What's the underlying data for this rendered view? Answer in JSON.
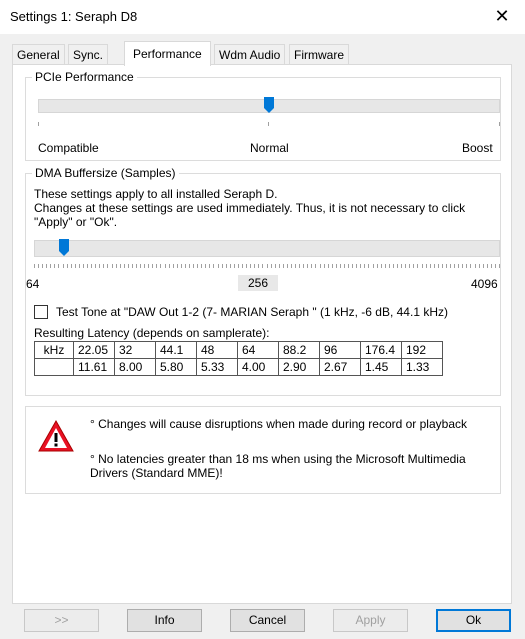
{
  "window": {
    "title": "Settings 1: Seraph D8",
    "close_symbol": "✕"
  },
  "tabs": [
    {
      "label": "General"
    },
    {
      "label": "Sync."
    },
    {
      "label": "Performance"
    },
    {
      "label": "Wdm Audio"
    },
    {
      "label": "Firmware"
    }
  ],
  "pcie": {
    "legend": "PCIe Performance",
    "labels": [
      "Compatible",
      "Normal",
      "Boost"
    ],
    "level": 0.5
  },
  "dma": {
    "legend": "DMA Buffersize (Samples)",
    "info_line1": "These settings apply to all installed Seraph D.",
    "info_line2": "Changes at these settings are used immediately. Thus, it is not necessary to click",
    "info_line3": "\"Apply\" or \"Ok\".",
    "min_label": "64",
    "current_value": "256",
    "max_label": "4096",
    "level": 0.055
  },
  "test_tone": {
    "label": "Test Tone at \"DAW Out  1-2 (7- MARIAN Seraph \" (1 kHz, -6 dB,  44.1 kHz)",
    "checked": false
  },
  "latency": {
    "caption": "Resulting Latency (depends on samplerate):",
    "header_unit": "kHz",
    "rates": [
      "22.05",
      "32",
      "44.1",
      "48",
      "64",
      "88.2",
      "96",
      "176.4",
      "192"
    ],
    "values": [
      "11.61",
      "8.00",
      "5.80",
      "5.33",
      "4.00",
      "2.90",
      "2.67",
      "1.45",
      "1.33"
    ]
  },
  "warning": {
    "line1": "° Changes will cause disruptions when made during record or playback",
    "line2a": "° No latencies greater than 18 ms when using the Microsoft Multimedia",
    "line2b": "Drivers (Standard MME)!",
    "icon": "warning-icon"
  },
  "buttons": {
    "more": ">>",
    "info": "Info",
    "cancel": "Cancel",
    "apply": "Apply",
    "ok": "Ok"
  },
  "colors": {
    "accent": "#0078d7",
    "warning_red": "#e81123"
  }
}
